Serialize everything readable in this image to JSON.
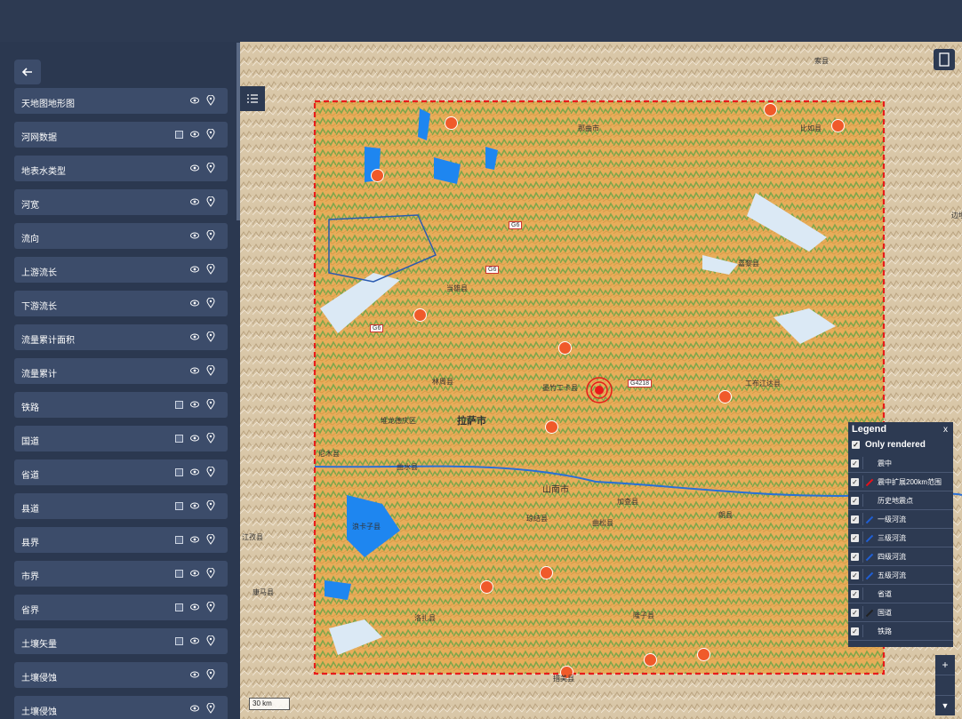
{
  "sidebar": {
    "layers": [
      {
        "label": "天地图地形图",
        "square": false
      },
      {
        "label": "河网数据",
        "square": true
      },
      {
        "label": "地表水类型",
        "square": false
      },
      {
        "label": "河宽",
        "square": false
      },
      {
        "label": "流向",
        "square": false
      },
      {
        "label": "上游流长",
        "square": false
      },
      {
        "label": "下游流长",
        "square": false
      },
      {
        "label": "流量累计面积",
        "square": false
      },
      {
        "label": "流量累计",
        "square": false
      },
      {
        "label": "铁路",
        "square": true
      },
      {
        "label": "国道",
        "square": true
      },
      {
        "label": "省道",
        "square": true
      },
      {
        "label": "县道",
        "square": true
      },
      {
        "label": "县界",
        "square": true
      },
      {
        "label": "市界",
        "square": true
      },
      {
        "label": "省界",
        "square": true
      },
      {
        "label": "土壤矢量",
        "square": true
      },
      {
        "label": "土壤侵蚀",
        "square": false
      },
      {
        "label": "土壤侵蚀",
        "square": false
      }
    ]
  },
  "map": {
    "labels": [
      "那曲市",
      "比如县",
      "当雄县",
      "林周县",
      "墨竹工卡县",
      "堆龙德庆区",
      "拉萨市",
      "曲水县",
      "尼木县",
      "山南市",
      "琼结县",
      "曲松县",
      "加查县",
      "浪卡子县",
      "洛扎县",
      "措美县",
      "隆子县",
      "工布江达县",
      "嘉黎县",
      "朗县",
      "江孜县",
      "康马县",
      "索县",
      "边坝",
      "G6",
      "G6",
      "G6",
      "G4218"
    ],
    "scale": "30 km"
  },
  "legend": {
    "title": "Legend",
    "close": "x",
    "only_rendered": "Only rendered",
    "items": [
      "震中",
      "震中扩展200km范围",
      "历史地震点",
      "一级河流",
      "三级河流",
      "四级河流",
      "五级河流",
      "省道",
      "国道",
      "铁路"
    ],
    "colors": {
      "epicenter": "#e8101a",
      "river": "#1f5fd6",
      "road": "#222222"
    }
  }
}
